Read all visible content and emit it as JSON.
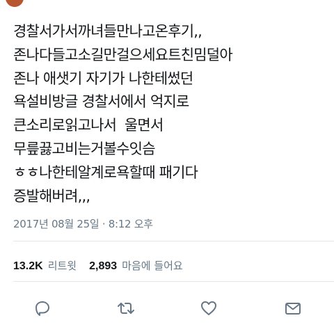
{
  "tweet": {
    "lines": [
      "경찰서가서까녀들만나고온후기,,",
      "존나다들고소길만걸으세요트친밈덜아",
      "존나 애샛기 자기가 나한테썼던",
      "욕설비방글 경찰서에서 억지로",
      "큰소리로읽고나서  울면서",
      "무릎끓고비는거볼수잇슴",
      "ㅎㅎ나한테알계로욕할때 패기다",
      "증발해버려,,,"
    ],
    "timestamp": "2017년 08월 25일 · 8:12 오후"
  },
  "stats": {
    "retweets_count": "13.2K",
    "retweets_label": "리트윗",
    "likes_count": "2,893",
    "likes_label": "마음에 들어요"
  },
  "actions": {
    "reply_icon": "reply-icon",
    "retweet_icon": "retweet-icon",
    "like_icon": "heart-icon",
    "dm_icon": "envelope-icon"
  },
  "colors": {
    "text": "#14171a",
    "secondary": "#657786",
    "divider": "#e1e8ed",
    "icon": "#657786"
  }
}
